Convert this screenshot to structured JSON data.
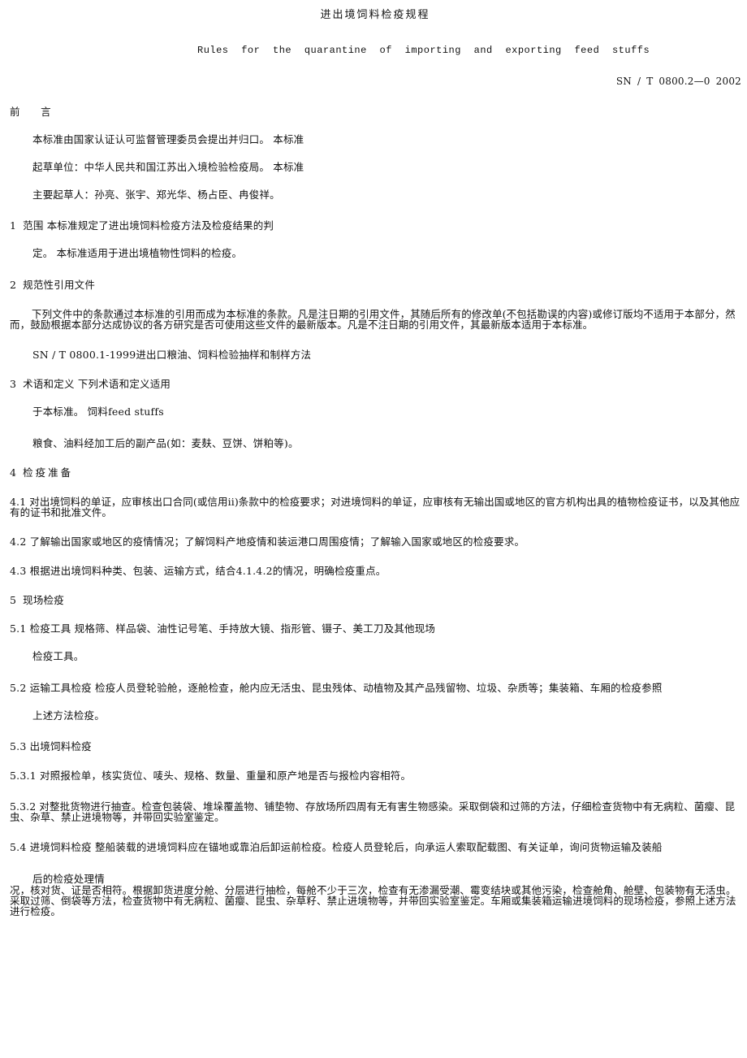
{
  "document": {
    "title": "进出境饲料检疫规程",
    "subtitle": "Rules  for  the  quarantine  of  importing  and  exporting  feed  stuffs",
    "code": "SN / T  0800.2—0 2002"
  },
  "foreword": {
    "heading": "前　　言",
    "lines": [
      "本标准由国家认证认可监督管理委员会提出并归口。 本标准",
      "起草单位：中华人民共和国江苏出入境检验检疫局。 本标准",
      "主要起草人：孙亮、张宇、郑光华、杨占臣、冉俊祥。"
    ]
  },
  "sections": {
    "s1": {
      "num": "1",
      "heading_line": "范围 本标准规定了进出境饲料检疫方法及检疫结果的判",
      "cont": "定。 本标准适用于进出境植物性饲料的检疫。"
    },
    "s2": {
      "num": "2",
      "heading": "规范性引用文件",
      "para": "下列文件中的条款通过本标准的引用而成为本标准的条款。凡是注日期的引用文件，其随后所有的修改单(不包括勘误的内容)或修订版均不适用于本部分，然而，鼓励根据本部分达成协议的各方研究是否可使用这些文件的最新版本。凡是不注日期的引用文件，其最新版本适用于本标准。",
      "ref": "SN / T  0800.1-1999进出口粮油、饲料检验抽样和制样方法"
    },
    "s3": {
      "num": "3",
      "heading_line": "术语和定义 下列术语和定义适用",
      "cont1": "于本标准。 饲料feed  stuffs",
      "cont2": "粮食、油料经加工后的副产品(如：麦麸、豆饼、饼粕等)。"
    },
    "s4": {
      "num": "4",
      "heading": "检疫准备",
      "s4_1": "4.1 对出境饲料的单证，应审核出口合同(或信用ii)条款中的检疫要求；对进境饲料的单证，应审核有无输出国或地区的官方机构出具的植物检疫证书，以及其他应有的证书和批准文件。",
      "s4_2": "4.2 了解输出国家或地区的疫情情况；了解饲料产地疫情和装运港口周围疫情；了解输入国家或地区的检疫要求。",
      "s4_3": "4.3 根据进出境饲料种类、包装、运输方式，结合4.1.4.2的情况，明确检疫重点。"
    },
    "s5": {
      "num": "5",
      "heading": "现场检疫",
      "s5_1": "5.1 检疫工具 规格筛、样品袋、油性记号笔、手持放大镜、指形管、镊子、美工刀及其他现场",
      "s5_1_cont": "检疫工具。",
      "s5_2": "5.2 运输工具检疫 检疫人员登轮验舱，逐舱检查，舱内应无活虫、昆虫残体、动植物及其产品残留物、垃圾、杂质等；集装箱、车厢的检疫参照",
      "s5_2_cont": "上述方法检疫。",
      "s5_3": "5.3 出境饲料检疫",
      "s5_3_1": "5.3.1 对照报检单，核实货位、唛头、规格、数量、重量和原产地是否与报检内容相符。",
      "s5_3_2": "5.3.2 对整批货物进行抽查。检查包装袋、堆垛覆盖物、铺垫物、存放场所四周有无有害生物感染。采取倒袋和过筛的方法，仔细检查货物中有无病粒、菌瘿、昆虫、杂草、禁止进境物等，并带回实验室鉴定。",
      "s5_4": "5.4 进境饲料检疫 整船装载的进境饲料应在锚地或靠泊后卸运前检疫。检疫人员登轮后，向承运人索取配载图、有关证单，询问货物运输及装船",
      "s5_4_cont": "后的检疫处理情",
      "s5_4_para": "况，核对货、证是否相符。根据卸货进度分舱、分层进行抽检，每舱不少于三次，检查有无渗漏受潮、霉变结块或其他污染，检查舱角、舱壁、包装物有无活虫。采取过筛、倒袋等方法，检查货物中有无病粒、菌瘿、昆虫、杂草籽、禁止进境物等，并带回实验室鉴定。车厢或集装箱运输进境饲料的现场检疫，参照上述方法进行检疫。"
    }
  }
}
